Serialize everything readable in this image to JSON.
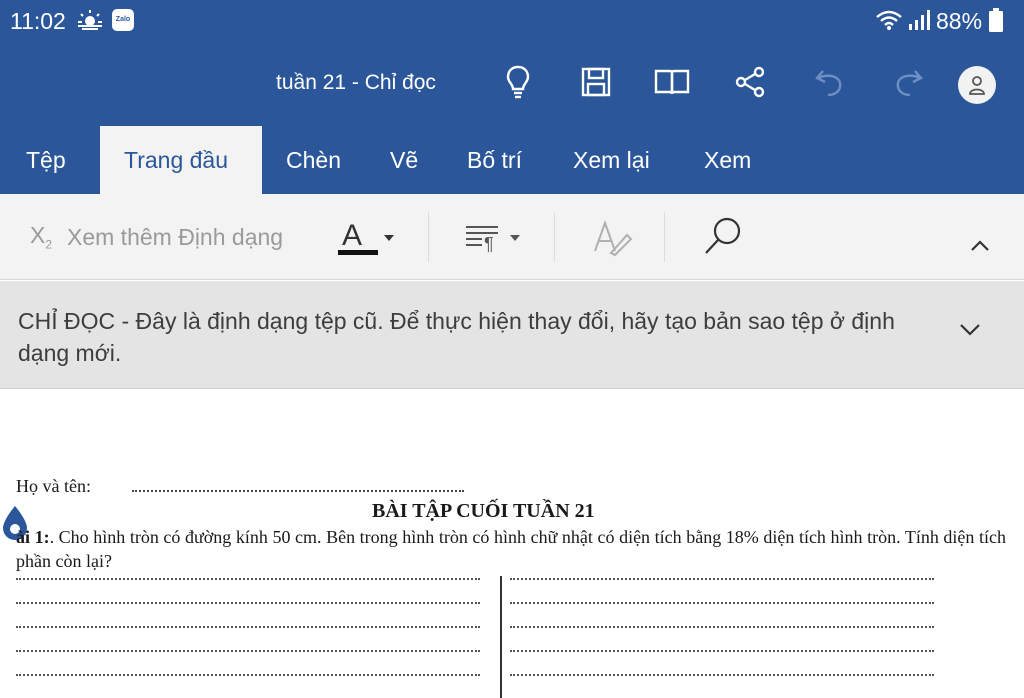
{
  "status_bar": {
    "time": "11:02",
    "zalo_label": "Zalo",
    "battery": "88%",
    "icons": [
      "weather-icon",
      "zalo-icon",
      "wifi-icon",
      "signal-icon",
      "battery-icon"
    ]
  },
  "title_bar": {
    "title": "tuần 21 - Chỉ đọc",
    "icons": [
      "lightbulb-icon",
      "save-icon",
      "reading-mode-icon",
      "share-icon",
      "undo-icon",
      "redo-icon",
      "account-icon"
    ]
  },
  "tabs": [
    {
      "label": "Tệp"
    },
    {
      "label": "Trang đầu",
      "active": true
    },
    {
      "label": "Chèn"
    },
    {
      "label": "Vẽ"
    },
    {
      "label": "Bố trí"
    },
    {
      "label": "Xem lại"
    },
    {
      "label": "Xem"
    }
  ],
  "ribbon": {
    "subscript_label": "X",
    "subscript_mark": "2",
    "more_formatting": "Xem thêm Định dạng",
    "font_color_letter": "A"
  },
  "banner": {
    "text": "CHỈ ĐỌC - Đây là định dạng tệp cũ. Để thực hiện thay đổi, hãy tạo bản sao tệp ở định dạng mới."
  },
  "document": {
    "name_label": "Họ và tên:",
    "heading": "BÀI TẬP CUỐI TUẦN 21",
    "exercise_label": "ài 1:",
    "exercise_text": ". Cho hình tròn có đường kính 50 cm. Bên trong hình tròn có hình chữ nhật có diện tích bằng 18% diện tích hình tròn. Tính diện tích phần còn lại?"
  },
  "colors": {
    "header_blue": "#2b579a",
    "ribbon_gray": "#f3f3f3",
    "banner_gray": "#e4e4e4"
  }
}
